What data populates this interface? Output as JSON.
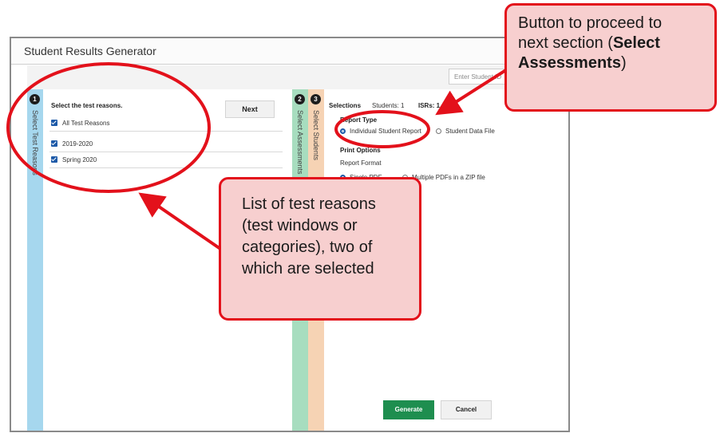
{
  "window": {
    "title": "Student Results Generator",
    "search_placeholder": "Enter Student ID"
  },
  "steps": [
    {
      "number": "1",
      "label": "Select Test Reasons"
    },
    {
      "number": "2",
      "label": "Select Assessments"
    },
    {
      "number": "3",
      "label": "Select Students"
    }
  ],
  "left_panel": {
    "heading": "Select the test reasons.",
    "next_label": "Next",
    "items": [
      {
        "label": "All Test Reasons",
        "checked": true
      },
      {
        "label": "2019-2020",
        "checked": true
      },
      {
        "label": "Spring 2020",
        "checked": true
      }
    ]
  },
  "right_panel": {
    "tab_label": "Selections",
    "students_label": "Students: 1",
    "isrs_label": "ISRs: 1",
    "report_type_heading": "Report Type",
    "report_type_options": [
      {
        "label": "Individual Student Report",
        "selected": true
      },
      {
        "label": "Student Data File",
        "selected": false
      }
    ],
    "print_options_heading": "Print Options",
    "report_format_label": "Report Format",
    "report_format_options": [
      {
        "label": "Single PDF",
        "selected": true
      },
      {
        "label": "Multiple PDFs in a ZIP file",
        "selected": false
      }
    ],
    "generate_label": "Generate",
    "cancel_label": "Cancel"
  },
  "callouts": {
    "next_button_callout": {
      "line1": "Button to proceed to",
      "line2_prefix": "next section (",
      "line2_bold": "Select",
      "line3_bold": "Assessments",
      "line3_suffix": ")"
    },
    "test_reasons_callout": {
      "lines": [
        "List of test reasons",
        "(test windows or",
        "categories), two of",
        "which are selected"
      ]
    }
  },
  "colors": {
    "callout_fill": "#f7cfcf",
    "callout_border": "#e3111b",
    "step1": "#a6d7ee",
    "step2": "#a7ddbf",
    "step3": "#f6d3b4",
    "generate": "#1e8e4f"
  }
}
